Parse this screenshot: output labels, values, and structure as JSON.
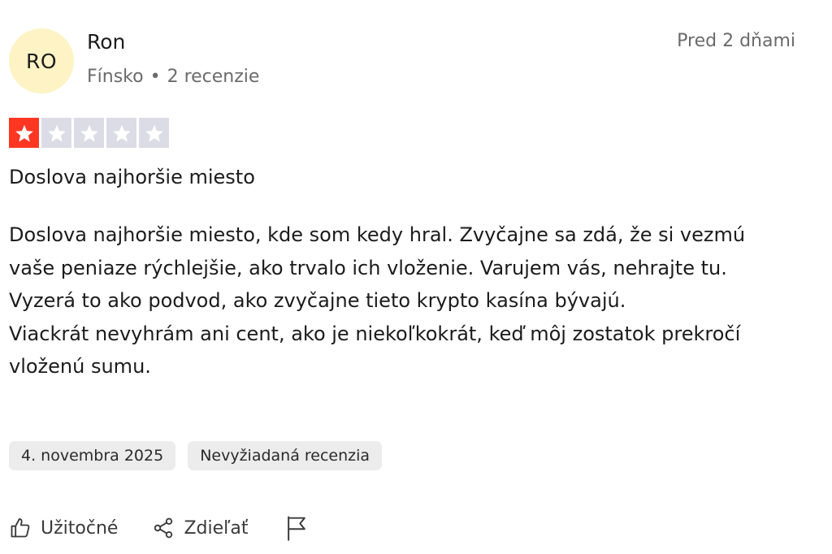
{
  "reviewer": {
    "initials": "RO",
    "name": "Ron",
    "country": "Fínsko",
    "separator": "•",
    "review_count": "2 recenzie",
    "avatar_color": "#fdf3c4"
  },
  "posted_ago": "Pred 2 dňami",
  "rating": {
    "value": 1,
    "max": 5,
    "filled_color": "#ff3722",
    "empty_color": "#dcdce6"
  },
  "review": {
    "title": "Doslova najhoršie miesto",
    "paragraph_1": "Doslova najhoršie miesto, kde som kedy hral. Zvyčajne sa zdá, že si vezmú vaše peniaze rýchlejšie, ako trvalo ich vloženie. Varujem vás, nehrajte tu. Vyzerá to ako podvod, ako zvyčajne tieto krypto kasína bývajú.",
    "paragraph_2": "Viackrát nevyhrám ani cent, ako je niekoľkokrát, keď môj zostatok prekročí vloženú sumu."
  },
  "tags": {
    "date": "4. novembra 2025",
    "type": "Nevyžiadaná recenzia"
  },
  "actions": {
    "useful_label": "Užitočné",
    "useful_icon": "thumbs-up-icon",
    "share_label": "Zdieľať",
    "share_icon": "share-icon",
    "report_icon": "flag-icon"
  }
}
